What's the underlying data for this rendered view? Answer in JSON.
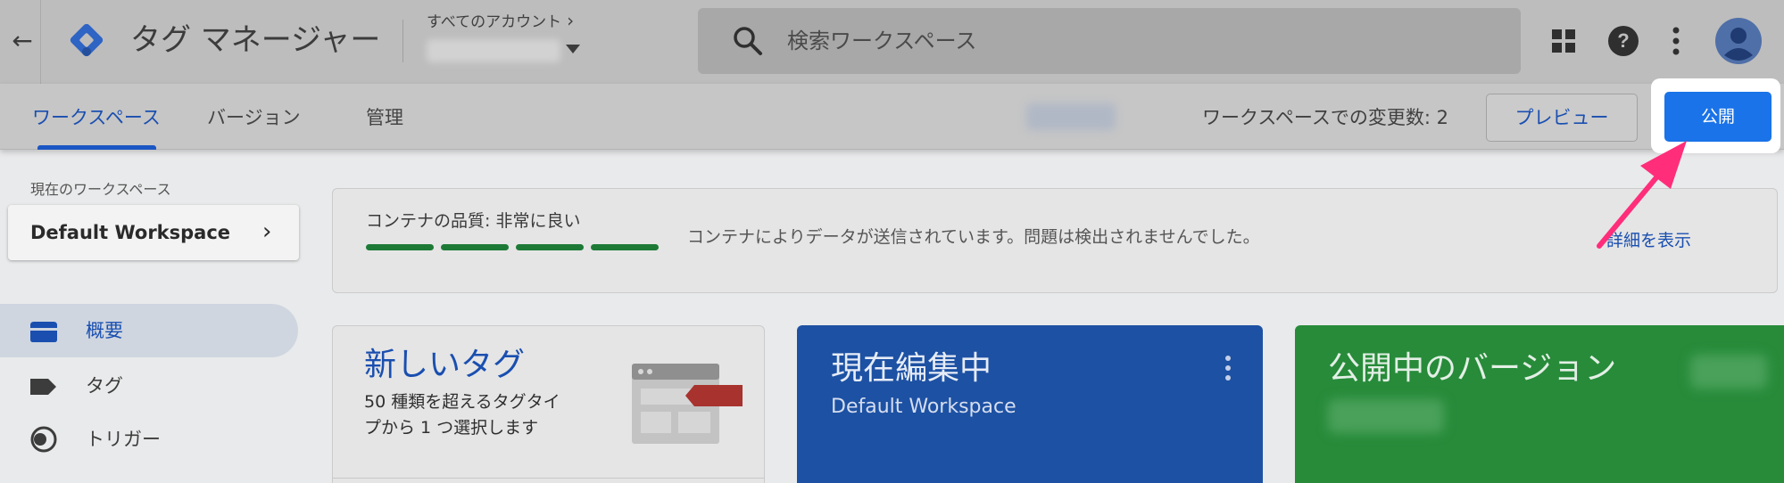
{
  "header": {
    "app_title": "タグ マネージャー",
    "account_label": "すべてのアカウント",
    "search_placeholder": "検索ワークスペース"
  },
  "tabs": [
    {
      "label": "ワークスペース",
      "active": true
    },
    {
      "label": "バージョン",
      "active": false
    },
    {
      "label": "管理",
      "active": false
    }
  ],
  "toolbar": {
    "changes_text": "ワークスペースでの変更数: 2",
    "preview_label": "プレビュー",
    "publish_label": "公開"
  },
  "sidebar": {
    "current_workspace_label": "現在のワークスペース",
    "workspace_name": "Default Workspace",
    "items": [
      {
        "label": "概要",
        "icon": "folder-icon",
        "active": true
      },
      {
        "label": "タグ",
        "icon": "tag-icon",
        "active": false
      },
      {
        "label": "トリガー",
        "icon": "trigger-icon",
        "active": false
      }
    ]
  },
  "quality": {
    "label": "コンテナの品質: 非常に良い",
    "message": "コンテナによりデータが送信されています。問題は検出されませんでした。",
    "link": "詳細を表示"
  },
  "cards": {
    "new_tag": {
      "title": "新しいタグ",
      "description": "50 種類を超えるタグタイプから 1 つ選択します"
    },
    "editing": {
      "title": "現在編集中",
      "subtitle": "Default Workspace"
    },
    "live": {
      "title": "公開中のバージョン"
    }
  },
  "colors": {
    "accent_blue": "#1a73e8",
    "link_blue": "#1a4fb0",
    "editing_card": "#1d51a3",
    "live_card": "#278b3a",
    "quality_green": "#1d7a36",
    "annotation_pink": "#ff2d7a"
  }
}
